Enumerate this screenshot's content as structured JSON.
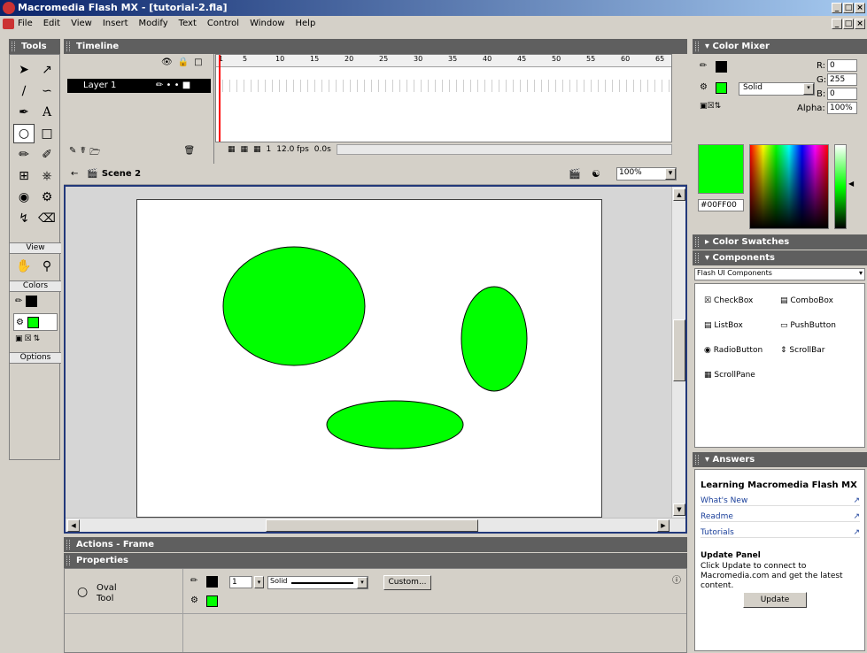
{
  "window": {
    "title": "Macromedia Flash MX - [tutorial-2.fla]",
    "controls": [
      "_",
      "□",
      "×"
    ]
  },
  "menu": [
    "File",
    "Edit",
    "View",
    "Insert",
    "Modify",
    "Text",
    "Control",
    "Window",
    "Help"
  ],
  "tools": {
    "title": "Tools",
    "view_label": "View",
    "colors_label": "Colors",
    "options_label": "Options"
  },
  "timeline": {
    "title": "Timeline",
    "layer_name": "Layer 1",
    "frame_numbers": [
      "1",
      "5",
      "10",
      "15",
      "20",
      "25",
      "30",
      "35",
      "40",
      "45",
      "50",
      "55",
      "60",
      "65"
    ],
    "current_frame": "1",
    "fps": "12.0 fps",
    "time": "0.0s"
  },
  "scene": {
    "name": "Scene 2",
    "zoom": "100%"
  },
  "color_mixer": {
    "title": "Color Mixer",
    "fill_type": "Solid",
    "r_label": "R:",
    "g_label": "G:",
    "b_label": "B:",
    "alpha_label": "Alpha:",
    "r": "0",
    "g": "255",
    "b": "0",
    "alpha": "100%",
    "hex": "#00FF00",
    "fill_color": "#00ff00",
    "stroke_color": "#000000"
  },
  "color_swatches": {
    "title": "Color Swatches"
  },
  "components": {
    "title": "Components",
    "set": "Flash UI Components",
    "items": [
      "CheckBox",
      "ComboBox",
      "ListBox",
      "PushButton",
      "RadioButton",
      "ScrollBar",
      "ScrollPane"
    ]
  },
  "answers": {
    "title": "Answers",
    "heading": "Learning Macromedia Flash MX",
    "links": [
      "What's New",
      "Readme",
      "Tutorials"
    ],
    "update_heading": "Update Panel",
    "update_text": "Click Update to connect to Macromedia.com and get the latest content.",
    "update_button": "Update"
  },
  "actions": {
    "title": "Actions - Frame"
  },
  "properties": {
    "title": "Properties",
    "tool_name": "Oval",
    "tool_sub": "Tool",
    "stroke_width": "1",
    "stroke_style": "Solid",
    "custom_button": "Custom..."
  }
}
